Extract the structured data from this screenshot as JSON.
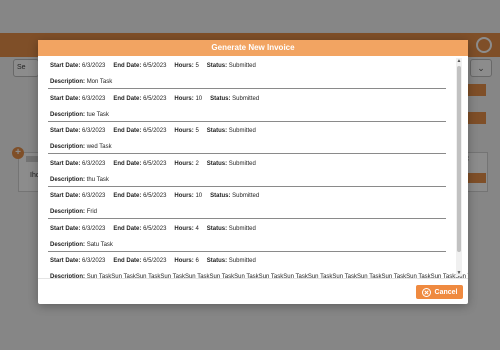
{
  "modal": {
    "title": "Generate New Invoice",
    "cancel_label": "Cancel"
  },
  "labels": {
    "start_date": "Start Date:",
    "end_date": "End Date:",
    "hours": "Hours:",
    "status": "Status:",
    "description": "Description:"
  },
  "entries": [
    {
      "start_date": "6/3/2023",
      "end_date": "6/5/2023",
      "hours": "5",
      "status": "Submitted",
      "description": "Mon Task"
    },
    {
      "start_date": "6/3/2023",
      "end_date": "6/5/2023",
      "hours": "10",
      "status": "Submitted",
      "description": "tue Task"
    },
    {
      "start_date": "6/3/2023",
      "end_date": "6/5/2023",
      "hours": "5",
      "status": "Submitted",
      "description": "wed Task"
    },
    {
      "start_date": "6/3/2023",
      "end_date": "6/5/2023",
      "hours": "2",
      "status": "Submitted",
      "description": "thu Task"
    },
    {
      "start_date": "6/3/2023",
      "end_date": "6/5/2023",
      "hours": "10",
      "status": "Submitted",
      "description": "Frid"
    },
    {
      "start_date": "6/3/2023",
      "end_date": "6/5/2023",
      "hours": "4",
      "status": "Submitted",
      "description": "Satu Task"
    },
    {
      "start_date": "6/3/2023",
      "end_date": "6/5/2023",
      "hours": "6",
      "status": "Submitted",
      "description": "Sun TaskSun TaskSun TaskSun TaskSun TaskSun TaskSun TaskSun TaskSun TaskSun TaskSun TaskSun TaskSun TaskSun TaskSun TaskSun TaskSun TaskSun TaskSun"
    }
  ],
  "background": {
    "search_text": "Se",
    "card_text": "Ihq"
  },
  "colors": {
    "accent": "#ef8a40",
    "header": "#f2a462"
  },
  "icons": {
    "cancel": "close-circle-icon",
    "settings": "gear-icon",
    "add": "plus-icon"
  }
}
